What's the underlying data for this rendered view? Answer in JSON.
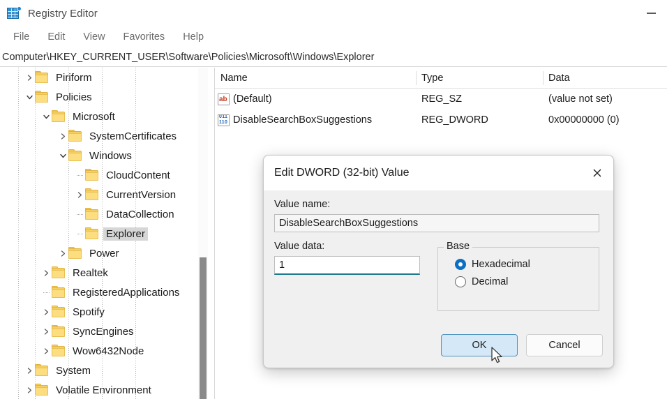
{
  "window": {
    "title": "Registry Editor",
    "icon": "registry-editor-icon",
    "minimize_label": "Minimize"
  },
  "menubar": {
    "items": [
      "File",
      "Edit",
      "View",
      "Favorites",
      "Help"
    ]
  },
  "address": {
    "path": "Computer\\HKEY_CURRENT_USER\\Software\\Policies\\Microsoft\\Windows\\Explorer"
  },
  "tree": {
    "nodes": [
      {
        "label": "Piriform",
        "depth": 1,
        "state": "collapsed",
        "selected": false
      },
      {
        "label": "Policies",
        "depth": 1,
        "state": "expanded",
        "selected": false
      },
      {
        "label": "Microsoft",
        "depth": 2,
        "state": "expanded",
        "selected": false
      },
      {
        "label": "SystemCertificates",
        "depth": 3,
        "state": "collapsed",
        "selected": false
      },
      {
        "label": "Windows",
        "depth": 3,
        "state": "expanded",
        "selected": false
      },
      {
        "label": "CloudContent",
        "depth": 4,
        "state": "leaf",
        "selected": false
      },
      {
        "label": "CurrentVersion",
        "depth": 4,
        "state": "collapsed",
        "selected": false
      },
      {
        "label": "DataCollection",
        "depth": 4,
        "state": "leaf",
        "selected": false
      },
      {
        "label": "Explorer",
        "depth": 4,
        "state": "leaf",
        "selected": true
      },
      {
        "label": "Power",
        "depth": 3,
        "state": "collapsed",
        "selected": false
      },
      {
        "label": "Realtek",
        "depth": 2,
        "state": "collapsed",
        "selected": false
      },
      {
        "label": "RegisteredApplications",
        "depth": 2,
        "state": "leaf",
        "selected": false
      },
      {
        "label": "Spotify",
        "depth": 2,
        "state": "collapsed",
        "selected": false
      },
      {
        "label": "SyncEngines",
        "depth": 2,
        "state": "collapsed",
        "selected": false
      },
      {
        "label": "Wow6432Node",
        "depth": 2,
        "state": "collapsed",
        "selected": false
      },
      {
        "label": "System",
        "depth": 1,
        "state": "collapsed",
        "selected": false
      },
      {
        "label": "Volatile Environment",
        "depth": 1,
        "state": "collapsed",
        "selected": false
      }
    ]
  },
  "list": {
    "columns": [
      "Name",
      "Type",
      "Data"
    ],
    "rows": [
      {
        "icon": "string-value-icon",
        "icon_text": "ab",
        "name": "(Default)",
        "type": "REG_SZ",
        "data": "(value not set)"
      },
      {
        "icon": "dword-value-icon",
        "icon_text": "011\n110",
        "name": "DisableSearchBoxSuggestions",
        "type": "REG_DWORD",
        "data": "0x00000000 (0)"
      }
    ]
  },
  "dialog": {
    "title": "Edit DWORD (32-bit) Value",
    "close_icon": "close-icon",
    "value_name_label": "Value name:",
    "value_name": "DisableSearchBoxSuggestions",
    "value_data_label": "Value data:",
    "value_data": "1",
    "base_legend": "Base",
    "base_options": [
      {
        "label": "Hexadecimal",
        "selected": true
      },
      {
        "label": "Decimal",
        "selected": false
      }
    ],
    "ok_label": "OK",
    "cancel_label": "Cancel"
  },
  "colors": {
    "accent": "#0b6fc4",
    "focus_underline": "#1a7a8c",
    "primary_button_bg": "#d4e8f7",
    "primary_button_border": "#4f93bd",
    "folder": "#fcdd7f",
    "selection": "#d6d6d6"
  }
}
